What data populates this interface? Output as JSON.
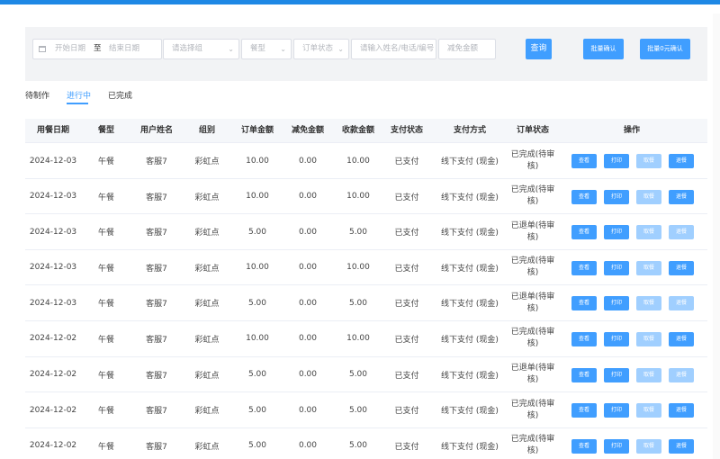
{
  "filters": {
    "date_start_placeholder": "开始日期",
    "date_separator": "至",
    "date_end_placeholder": "结束日期",
    "group_placeholder": "请选择组",
    "meal_placeholder": "餐型",
    "order_status_placeholder": "订单状态",
    "search_input_placeholder": "请输入姓名/电话/编号",
    "discount_placeholder": "减免金额",
    "search_label": "查询",
    "batch_confirm_label": "批量确认",
    "batch_zero_confirm_label": "批量0元确认"
  },
  "tabs": [
    {
      "label": "待制作",
      "active": false
    },
    {
      "label": "进行中",
      "active": true
    },
    {
      "label": "已完成",
      "active": false
    }
  ],
  "table": {
    "columns": [
      "用餐日期",
      "餐型",
      "用户姓名",
      "组别",
      "订单金额",
      "减免金额",
      "收款金额",
      "支付状态",
      "支付方式",
      "订单状态",
      "操作"
    ],
    "actions": [
      "查看",
      "打印",
      "取餐",
      "退餐"
    ],
    "rows": [
      {
        "date": "2024-12-03",
        "meal": "午餐",
        "user": "客服7",
        "group": "彩虹点",
        "amount": "10.00",
        "discount": "0.00",
        "received": "10.00",
        "pay_status": "已支付",
        "pay_method": "线下支付 (现金)",
        "order_status": "已完成(待审核)",
        "refund_enabled": true
      },
      {
        "date": "2024-12-03",
        "meal": "午餐",
        "user": "客服7",
        "group": "彩虹点",
        "amount": "10.00",
        "discount": "0.00",
        "received": "10.00",
        "pay_status": "已支付",
        "pay_method": "线下支付 (现金)",
        "order_status": "已完成(待审核)",
        "refund_enabled": true
      },
      {
        "date": "2024-12-03",
        "meal": "午餐",
        "user": "客服7",
        "group": "彩虹点",
        "amount": "5.00",
        "discount": "0.00",
        "received": "5.00",
        "pay_status": "已支付",
        "pay_method": "线下支付 (现金)",
        "order_status": "已退单(待审核)",
        "refund_enabled": false
      },
      {
        "date": "2024-12-03",
        "meal": "午餐",
        "user": "客服7",
        "group": "彩虹点",
        "amount": "10.00",
        "discount": "0.00",
        "received": "10.00",
        "pay_status": "已支付",
        "pay_method": "线下支付 (现金)",
        "order_status": "已完成(待审核)",
        "refund_enabled": true
      },
      {
        "date": "2024-12-03",
        "meal": "午餐",
        "user": "客服7",
        "group": "彩虹点",
        "amount": "5.00",
        "discount": "0.00",
        "received": "5.00",
        "pay_status": "已支付",
        "pay_method": "线下支付 (现金)",
        "order_status": "已退单(待审核)",
        "refund_enabled": false
      },
      {
        "date": "2024-12-02",
        "meal": "午餐",
        "user": "客服7",
        "group": "彩虹点",
        "amount": "10.00",
        "discount": "0.00",
        "received": "10.00",
        "pay_status": "已支付",
        "pay_method": "线下支付 (现金)",
        "order_status": "已完成(待审核)",
        "refund_enabled": true
      },
      {
        "date": "2024-12-02",
        "meal": "午餐",
        "user": "客服7",
        "group": "彩虹点",
        "amount": "5.00",
        "discount": "0.00",
        "received": "5.00",
        "pay_status": "已支付",
        "pay_method": "线下支付 (现金)",
        "order_status": "已退单(待审核)",
        "refund_enabled": false
      },
      {
        "date": "2024-12-02",
        "meal": "午餐",
        "user": "客服7",
        "group": "彩虹点",
        "amount": "5.00",
        "discount": "0.00",
        "received": "5.00",
        "pay_status": "已支付",
        "pay_method": "线下支付 (现金)",
        "order_status": "已完成(待审核)",
        "refund_enabled": true
      },
      {
        "date": "2024-12-02",
        "meal": "午餐",
        "user": "客服7",
        "group": "彩虹点",
        "amount": "5.00",
        "discount": "0.00",
        "received": "5.00",
        "pay_status": "已支付",
        "pay_method": "线下支付 (现金)",
        "order_status": "已完成(待审核)",
        "refund_enabled": true
      }
    ]
  },
  "colors": {
    "accent": "#409eff",
    "accent_disabled": "#a0cfff",
    "topbar": "#1e88e5"
  }
}
